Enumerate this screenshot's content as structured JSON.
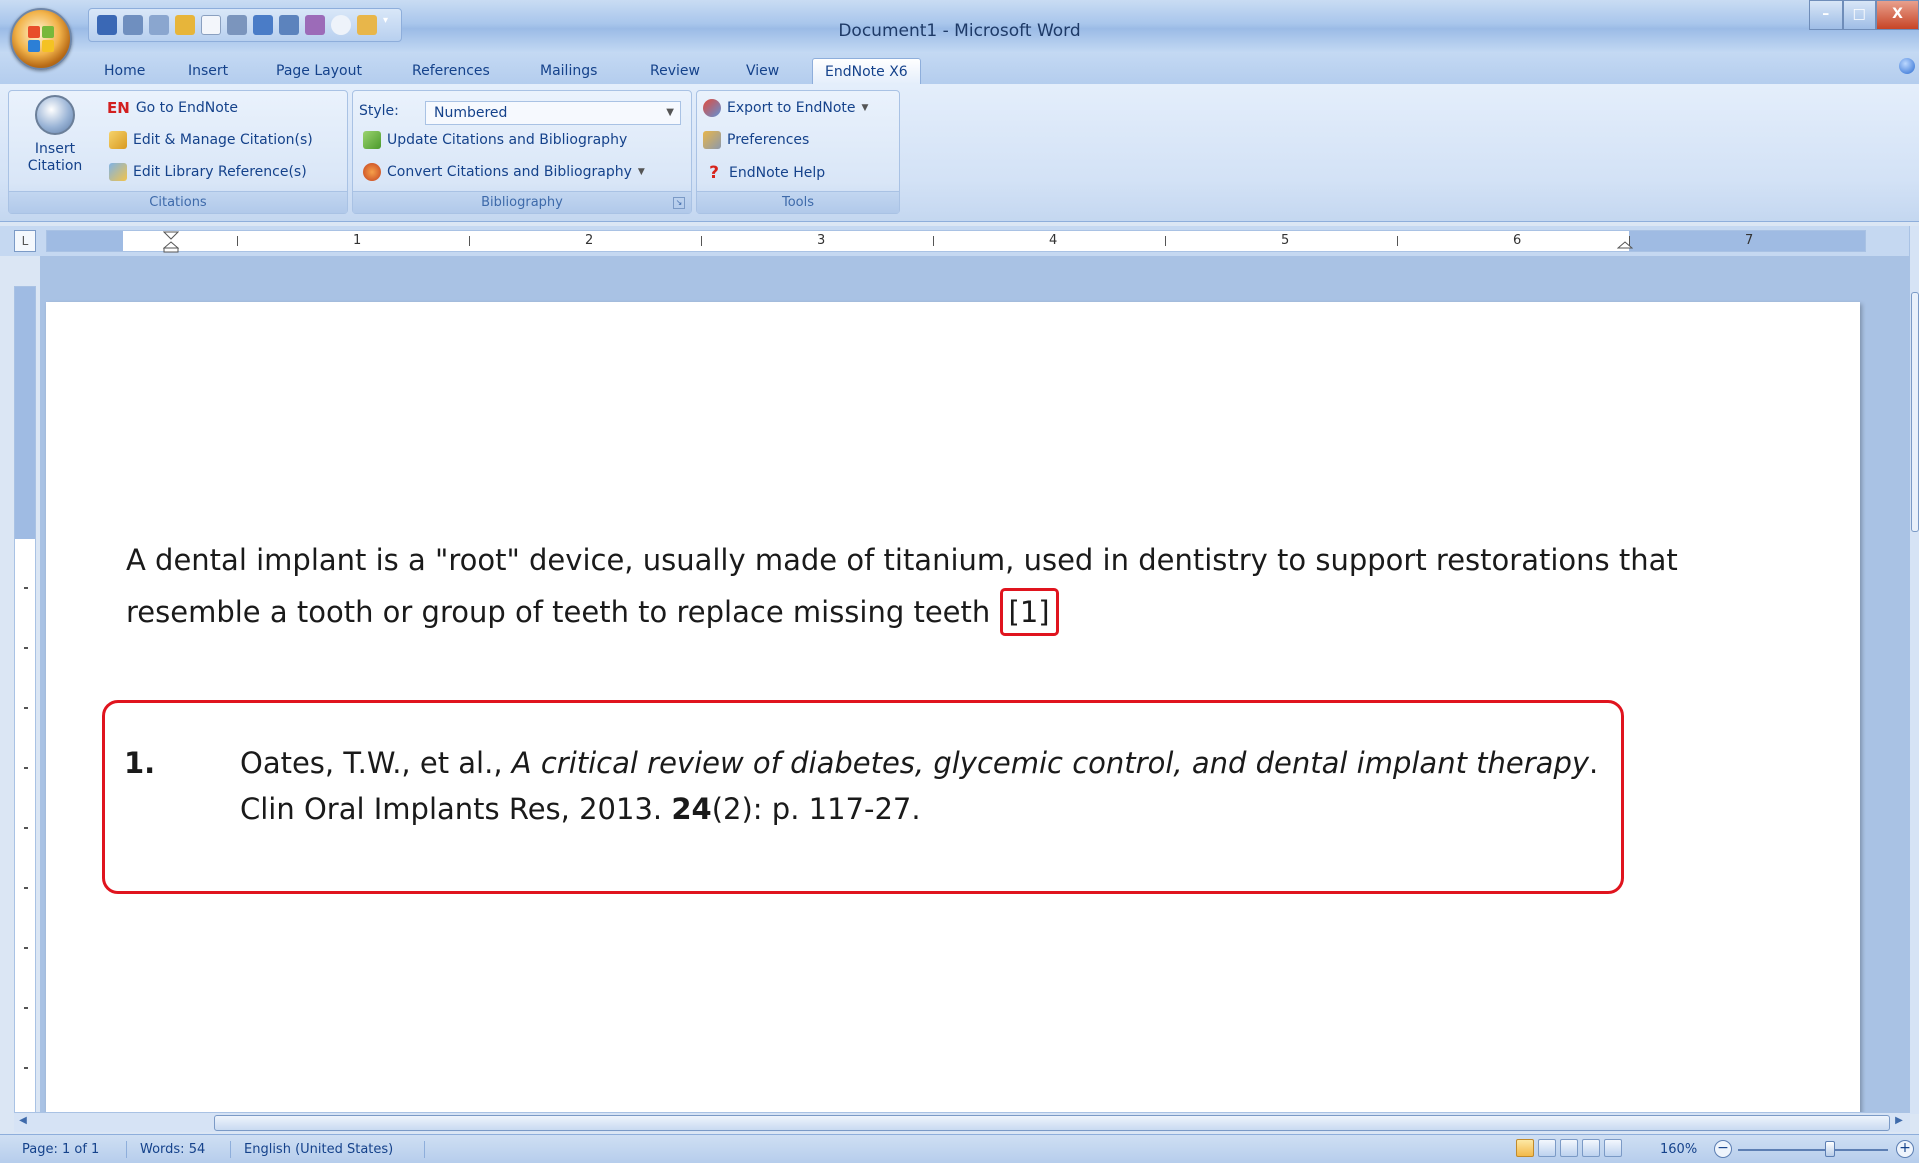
{
  "window": {
    "title": "Document1 - Microsoft Word",
    "controls": [
      "–",
      "□",
      "X"
    ]
  },
  "tabs": [
    "Home",
    "Insert",
    "Page Layout",
    "References",
    "Mailings",
    "Review",
    "View",
    "EndNote X6"
  ],
  "active_tab": "EndNote X6",
  "ribbon": {
    "citations": {
      "insert_citation": "Insert Citation",
      "go_to_endnote_badge": "EN",
      "go_to_endnote": "Go to EndNote",
      "edit_manage": "Edit & Manage Citation(s)",
      "edit_library": "Edit Library Reference(s)",
      "label": "Citations"
    },
    "bibliography": {
      "style_label": "Style:",
      "style_value": "Numbered",
      "update": "Update Citations and Bibliography",
      "convert": "Convert Citations and Bibliography",
      "label": "Bibliography"
    },
    "tools": {
      "export": "Export to EndNote",
      "preferences": "Preferences",
      "help": "EndNote Help",
      "label": "Tools"
    }
  },
  "ruler": {
    "numbers": [
      "1",
      "2",
      "3",
      "4",
      "5",
      "6",
      "7"
    ]
  },
  "document": {
    "paragraph": "A dental implant is a \"root\" device, usually made of titanium, used in dentistry to support restorations that resemble a tooth or group of teeth to replace missing teeth",
    "citation": "[1]",
    "bibliography": {
      "number": "1.",
      "authors": "Oates, T.W., et al., ",
      "title": "A critical review of diabetes, glycemic control, and dental implant therapy",
      "after_title": ". Clin Oral Implants Res, 2013. ",
      "volume": "24",
      "issue_pages": "(2): p. 117-27."
    }
  },
  "status": {
    "page": "Page: 1 of 1",
    "words": "Words: 54",
    "language": "English (United States)",
    "zoom": "160%"
  },
  "colors": {
    "highlight": "#e0141e",
    "ribbon_text": "#15428b"
  }
}
